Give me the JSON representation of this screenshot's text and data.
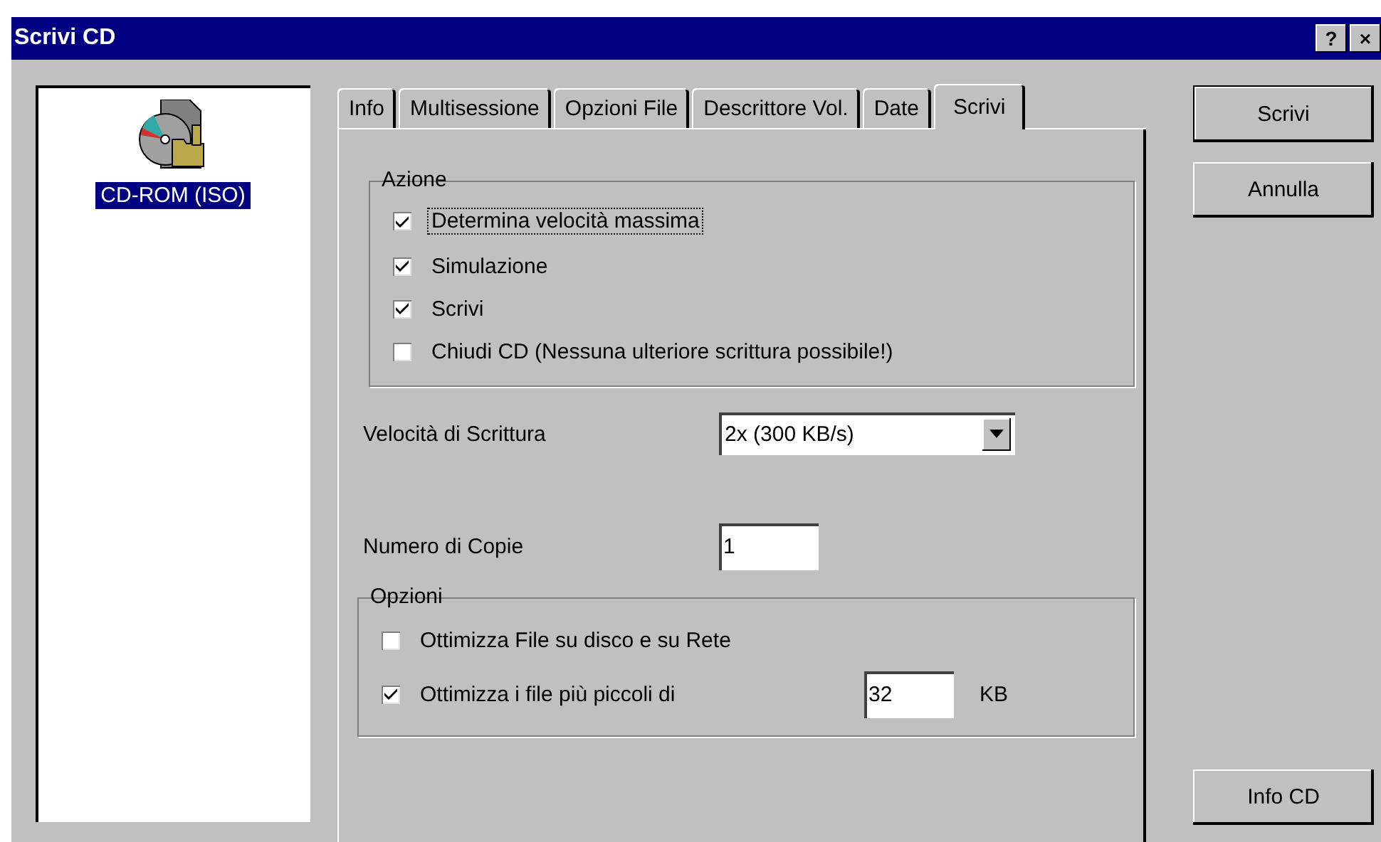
{
  "window": {
    "title": "Scrivi CD",
    "title_buttons": [
      "?",
      "×"
    ]
  },
  "sidebar": {
    "items": [
      {
        "label": "CD-ROM (ISO)",
        "selected": true
      }
    ]
  },
  "tabs": [
    {
      "label": "Info",
      "selected": false
    },
    {
      "label": "Multisessione",
      "selected": false
    },
    {
      "label": "Opzioni File",
      "selected": false
    },
    {
      "label": "Descrittore Vol.",
      "selected": false
    },
    {
      "label": "Date",
      "selected": false
    },
    {
      "label": "Scrivi",
      "selected": true
    }
  ],
  "azione": {
    "title": "Azione",
    "options": [
      {
        "label": "Determina velocità massima",
        "checked": true,
        "focused": true
      },
      {
        "label": "Simulazione",
        "checked": true,
        "focused": false
      },
      {
        "label": "Scrivi",
        "checked": true,
        "focused": false
      },
      {
        "label": "Chiudi CD (Nessuna ulteriore scrittura possibile!)",
        "checked": false,
        "focused": false
      }
    ]
  },
  "speed": {
    "label": "Velocità di Scrittura",
    "value": "2x (300 KB/s)"
  },
  "copies": {
    "label": "Numero di Copie",
    "value": "1"
  },
  "opzioni": {
    "title": "Opzioni",
    "options": [
      {
        "label": "Ottimizza File su disco e su Rete",
        "checked": false
      },
      {
        "label": "Ottimizza i file più piccoli di",
        "checked": true,
        "value": "32",
        "unit": "KB"
      }
    ]
  },
  "buttons": [
    {
      "label": "Scrivi",
      "default": true
    },
    {
      "label": "Annulla",
      "default": false
    }
  ],
  "bottom_buttons": [
    {
      "label": "Info CD",
      "default": false
    }
  ]
}
